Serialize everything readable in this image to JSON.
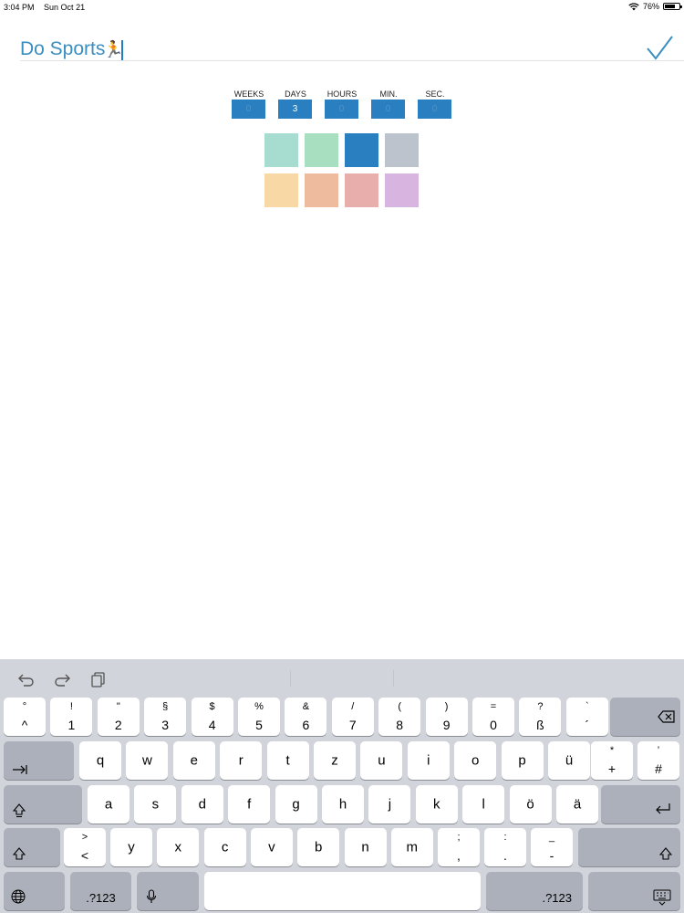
{
  "status_bar": {
    "time": "3:04 PM",
    "date": "Sun Oct 21",
    "battery": "76%",
    "battery_level": 0.76
  },
  "title": {
    "text": "Do Sports",
    "emoji": "🏃",
    "emoji_name": "runner-emoji"
  },
  "save_icon": "checkmark-icon",
  "duration": {
    "labels": [
      "WEEKS",
      "DAYS",
      "HOURS",
      "MIN.",
      "SEC."
    ],
    "values": [
      "0",
      "3",
      "0",
      "0",
      "0"
    ]
  },
  "colors": {
    "swatches": [
      "#a6ddd0",
      "#a7dfc0",
      "#2a7fc0",
      "#bcc3cc",
      "#f8d9a6",
      "#efbb9e",
      "#e8aeab",
      "#d8b5e0"
    ],
    "selected_index": 2,
    "accent": "#3b8ec0"
  },
  "keyboard": {
    "toolbar": [
      "undo-icon",
      "redo-icon",
      "paste-icon"
    ],
    "row1": [
      {
        "top": "°",
        "bottom": "^"
      },
      {
        "top": "!",
        "bottom": "1"
      },
      {
        "top": "\"",
        "bottom": "2"
      },
      {
        "top": "§",
        "bottom": "3"
      },
      {
        "top": "$",
        "bottom": "4"
      },
      {
        "top": "%",
        "bottom": "5"
      },
      {
        "top": "&",
        "bottom": "6"
      },
      {
        "top": "/",
        "bottom": "7"
      },
      {
        "top": "(",
        "bottom": "8"
      },
      {
        "top": ")",
        "bottom": "9"
      },
      {
        "top": "=",
        "bottom": "0"
      },
      {
        "top": "?",
        "bottom": "ß"
      },
      {
        "top": "`",
        "bottom": "´"
      }
    ],
    "row2": [
      "q",
      "w",
      "e",
      "r",
      "t",
      "z",
      "u",
      "i",
      "o",
      "p",
      "ü"
    ],
    "row2_extra": [
      {
        "top": "*",
        "bottom": "+"
      },
      {
        "top": "’",
        "bottom": "#"
      }
    ],
    "row3": [
      "a",
      "s",
      "d",
      "f",
      "g",
      "h",
      "j",
      "k",
      "l",
      "ö",
      "ä"
    ],
    "row4": [
      "y",
      "x",
      "c",
      "v",
      "b",
      "n",
      "m"
    ],
    "row4_pairs": [
      {
        "top": ">",
        "bottom": "<"
      },
      {
        "top": ";",
        "bottom": ","
      },
      {
        "top": ":",
        "bottom": "."
      },
      {
        "top": "_",
        "bottom": "-"
      }
    ],
    "numbers_label": ".?123"
  }
}
